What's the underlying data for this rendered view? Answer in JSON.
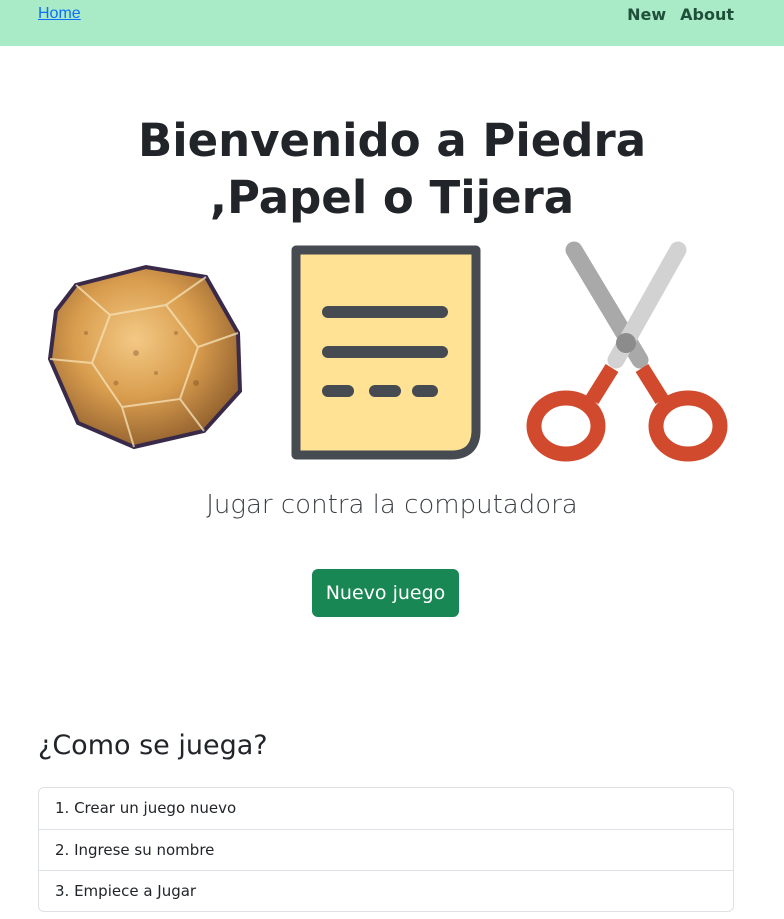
{
  "nav": {
    "home_label": "Home",
    "new_label": "New",
    "about_label": "About",
    "background": "#a9ebc7"
  },
  "hero": {
    "title": "Bienvenido a Piedra ,Papel o Tijera",
    "images": [
      "rock-illustration",
      "paper-document-icon",
      "scissors-icon"
    ],
    "subtitle": "Jugar contra la computadora",
    "button_label": "Nuevo juego",
    "button_color": "#198754"
  },
  "how_to_play": {
    "title": "¿Como se juega?",
    "steps": [
      "1. Crear un juego nuevo",
      "2. Ingrese su nombre",
      "3. Empiece a Jugar"
    ]
  }
}
